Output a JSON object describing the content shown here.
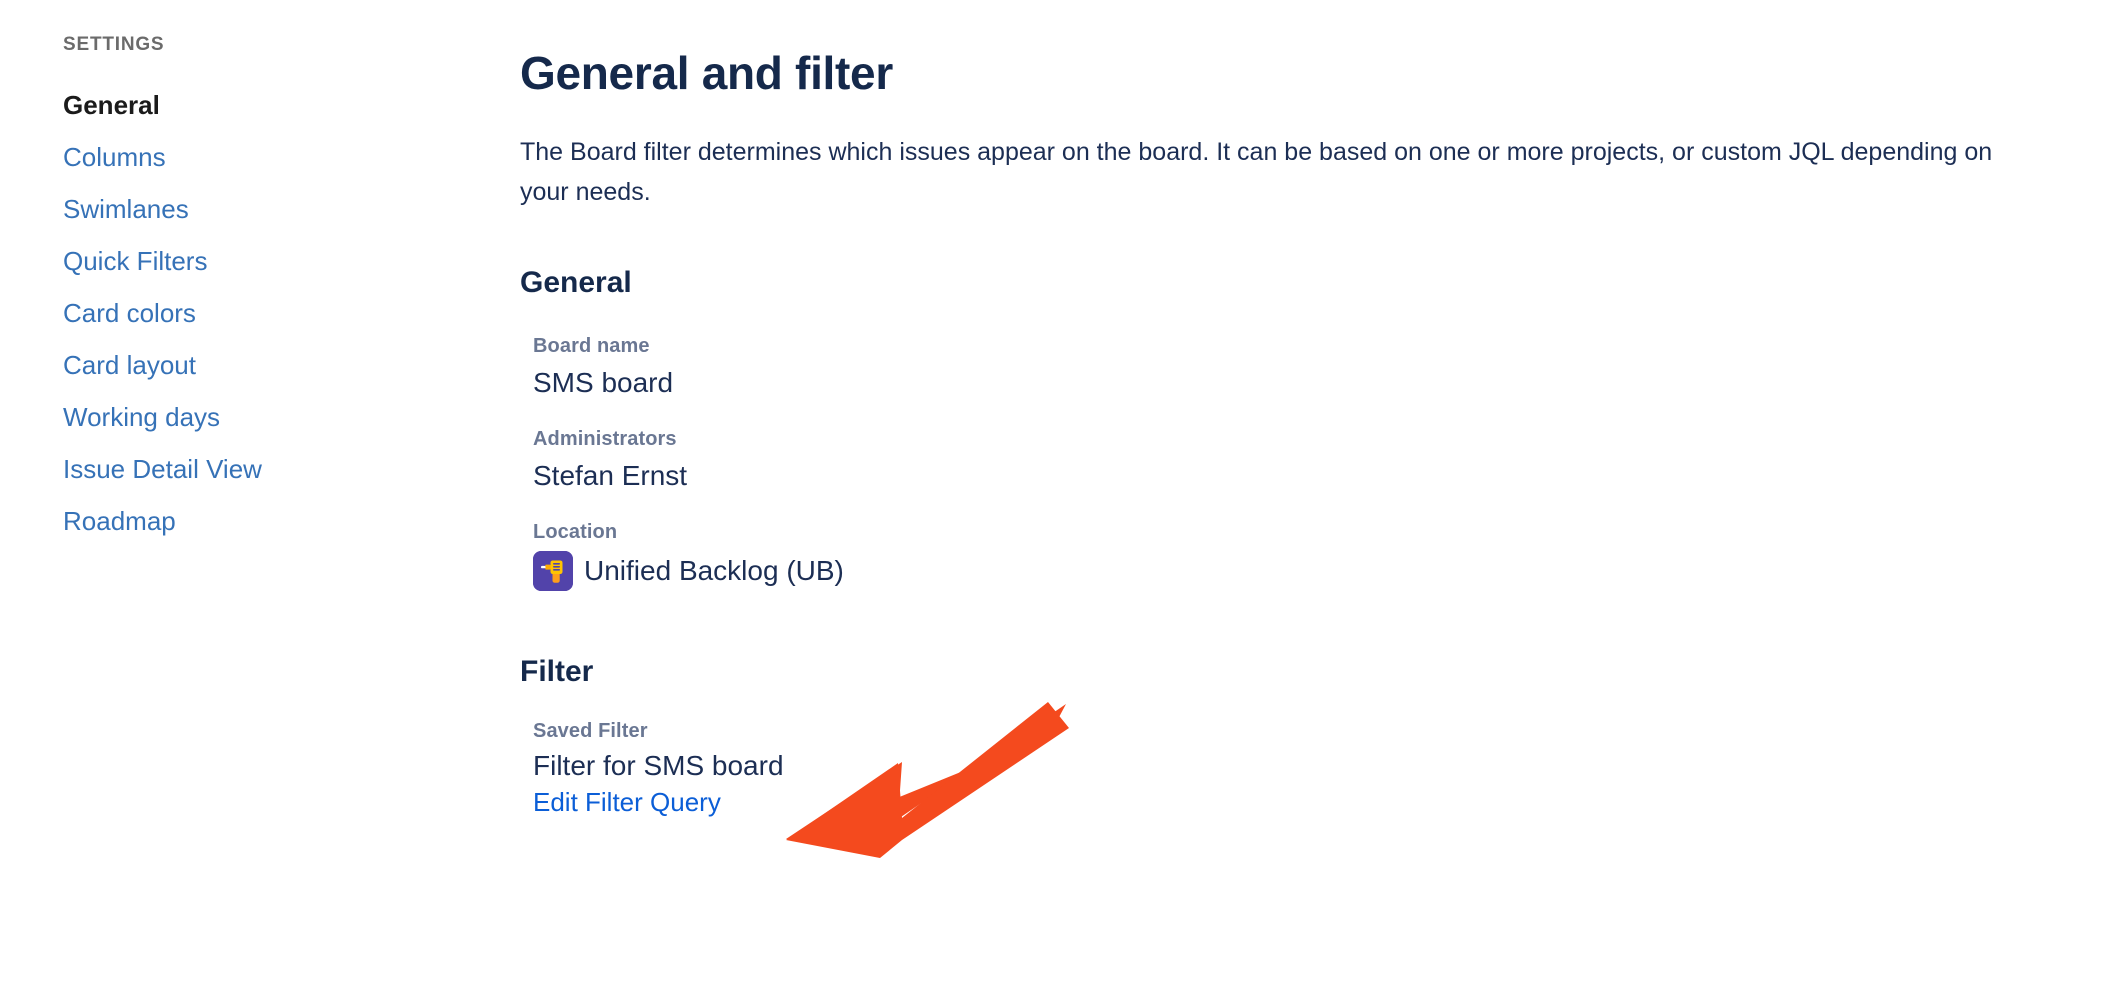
{
  "sidebar": {
    "heading": "SETTINGS",
    "items": [
      {
        "label": "General",
        "active": true,
        "name": "sidebar-item-general"
      },
      {
        "label": "Columns",
        "active": false,
        "name": "sidebar-item-columns"
      },
      {
        "label": "Swimlanes",
        "active": false,
        "name": "sidebar-item-swimlanes"
      },
      {
        "label": "Quick Filters",
        "active": false,
        "name": "sidebar-item-quick-filters"
      },
      {
        "label": "Card colors",
        "active": false,
        "name": "sidebar-item-card-colors"
      },
      {
        "label": "Card layout",
        "active": false,
        "name": "sidebar-item-card-layout"
      },
      {
        "label": "Working days",
        "active": false,
        "name": "sidebar-item-working-days"
      },
      {
        "label": "Issue Detail View",
        "active": false,
        "name": "sidebar-item-issue-detail-view"
      },
      {
        "label": "Roadmap",
        "active": false,
        "name": "sidebar-item-roadmap"
      }
    ]
  },
  "main": {
    "title": "General and filter",
    "description": "The Board filter determines which issues appear on the board. It can be based on one or more projects, or custom JQL depending on your needs.",
    "general": {
      "section_title": "General",
      "board_name_label": "Board name",
      "board_name_value": "SMS board",
      "administrators_label": "Administrators",
      "administrators_value": "Stefan Ernst",
      "location_label": "Location",
      "location_value": "Unified Backlog (UB)",
      "location_icon": "project-avatar-icon"
    },
    "filter": {
      "section_title": "Filter",
      "saved_filter_label": "Saved Filter",
      "saved_filter_value": "Filter for SMS board",
      "edit_filter_query_link": "Edit Filter Query"
    }
  },
  "annotation": {
    "arrow_icon": "arrow-pointing-down-left-icon",
    "color": "#f44a1e"
  },
  "colors": {
    "link_blue": "#3672b7",
    "action_blue": "#0b5ed7",
    "heading_navy": "#15294b",
    "label_gray": "#6a7793",
    "settings_gray": "#6b6b6b",
    "project_icon_purple": "#5243aa",
    "project_icon_yellow": "#ffc400",
    "annotation_red": "#f44a1e"
  }
}
